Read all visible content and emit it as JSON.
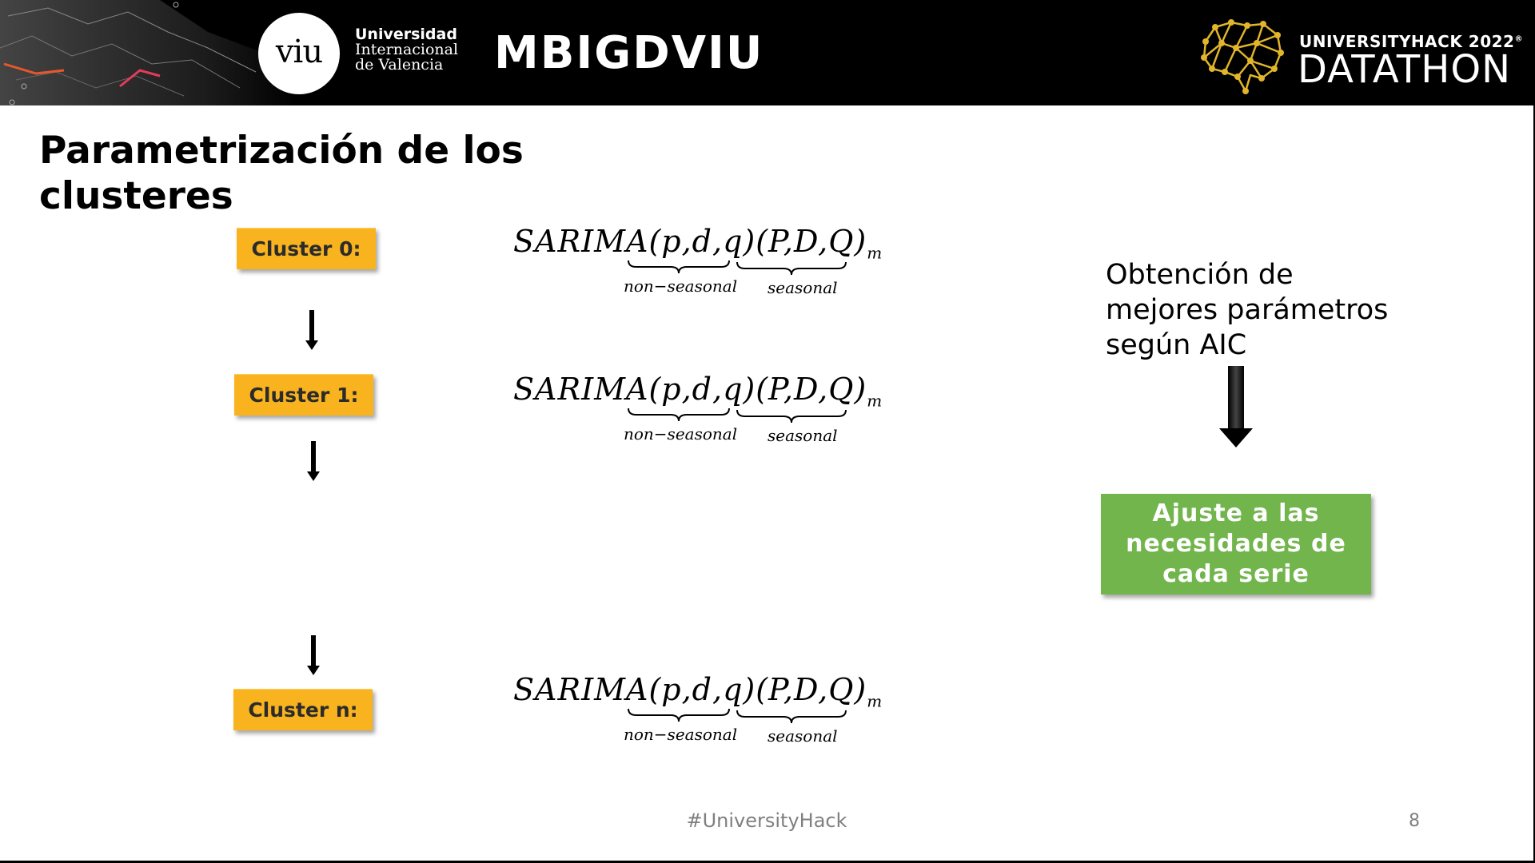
{
  "header": {
    "university_line1": "Universidad",
    "university_line2": "Internacional",
    "university_line3": "de Valencia",
    "logo_text": "viu",
    "team_title": "MBIGDVIU",
    "event_title": "UNIVERSITYHACK 2022",
    "event_name": "DATATHON",
    "registered_mark": "®"
  },
  "slide": {
    "title_line1": "Parametrización de los",
    "title_line2": "clusteres",
    "clusters": [
      {
        "label": "Cluster 0:"
      },
      {
        "label": "Cluster 1:"
      },
      {
        "label": "Cluster n:"
      }
    ],
    "formula": {
      "main": "SARIMA(p,d,q)(P,D,Q)",
      "subscript": "m",
      "nonseasonal_label": "non−seasonal",
      "seasonal_label": "seasonal"
    },
    "aic_text_line1": "Obtención de",
    "aic_text_line2": "mejores parámetros",
    "aic_text_line3": "según AIC",
    "result_box_line1": "Ajuste a las",
    "result_box_line2": "necesidades de",
    "result_box_line3": "cada serie"
  },
  "footer": {
    "hashtag": "#UniversityHack",
    "page_number": "8"
  },
  "colors": {
    "header_bg": "#000000",
    "cluster_box": "#f9b31f",
    "result_box": "#72b54c",
    "brain_icon": "#e2b52a",
    "accent_lines": "#e8572b"
  },
  "icons": {
    "brain": "brain-network-icon",
    "arrow": "down-arrow-icon"
  }
}
